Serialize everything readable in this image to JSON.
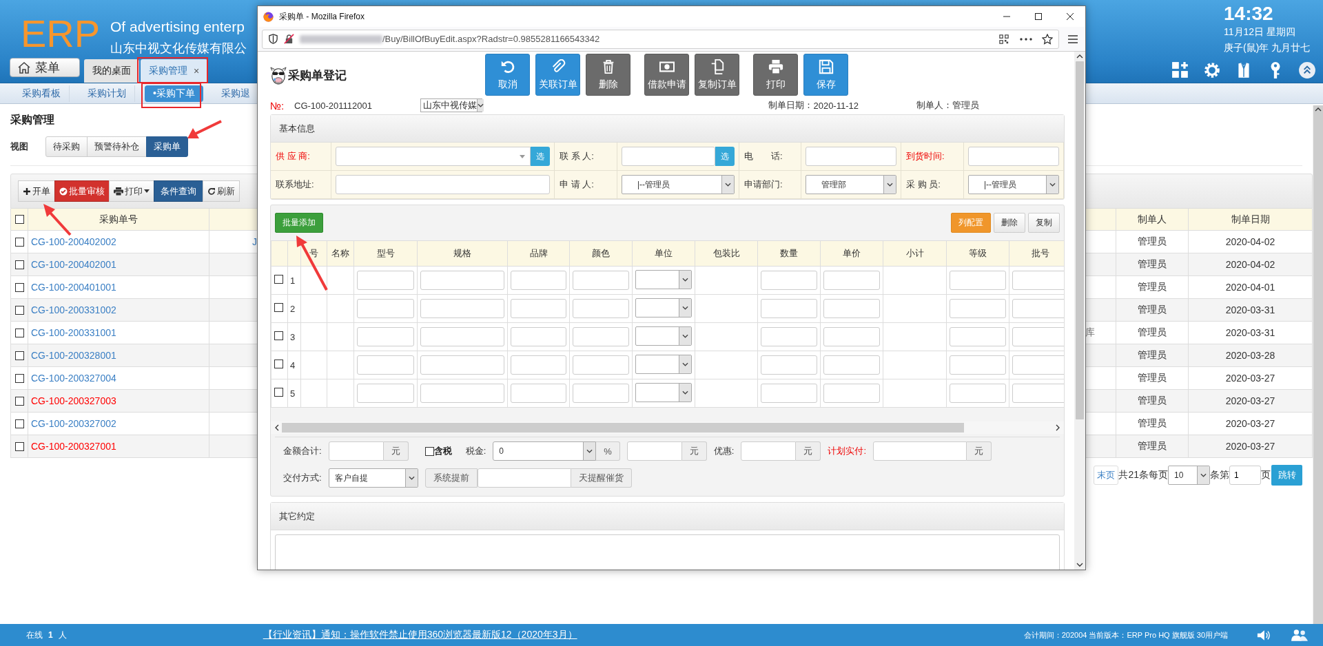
{
  "header": {
    "logo": "ERP",
    "slogan": "Of advertising enterp",
    "company": "山东中视文化传媒有限公",
    "menu_button": "菜单",
    "tabs": [
      {
        "label": "我的桌面",
        "selected": false,
        "closable": false
      },
      {
        "label": "采购管理",
        "selected": true,
        "closable": true,
        "close_label": "×"
      }
    ],
    "clock": {
      "time": "14:32",
      "date": "11月12日 星期四",
      "lunar": "庚子(鼠)年 九月廿七"
    },
    "tools": [
      {
        "kind": "apps"
      },
      {
        "kind": "settings"
      },
      {
        "kind": "shirt"
      },
      {
        "kind": "key"
      },
      {
        "kind": "collapse"
      }
    ]
  },
  "subnav": [
    {
      "label": "采购看板",
      "selected": false
    },
    {
      "label": "采购计划",
      "selected": false
    },
    {
      "label": "•采购下单",
      "selected": true
    },
    {
      "label": "采购退",
      "selected": false
    }
  ],
  "page": {
    "title": "采购管理",
    "view_label": "视图",
    "views": [
      {
        "label": "待采购",
        "selected": false
      },
      {
        "label": "预警待补仓",
        "selected": false
      },
      {
        "label": "采购单",
        "selected": true
      }
    ],
    "toolbar": [
      {
        "label": "开单",
        "kind": "add"
      },
      {
        "label": "批量审核",
        "kind": "approve"
      },
      {
        "label": "打印",
        "kind": "print"
      },
      {
        "label": "条件查询",
        "kind": "query"
      },
      {
        "label": "刷新",
        "kind": "refresh"
      }
    ],
    "table": {
      "all_checked": false,
      "columns": [
        "采购单号",
        "制单人",
        "制单日期"
      ],
      "rows": [
        {
          "checked": false,
          "number": "CG-100-200402002",
          "color": "#3a7fc4",
          "column_3": "J",
          "maker": "管理员",
          "date": "2020-04-02"
        },
        {
          "checked": false,
          "number": "CG-100-200402001",
          "color": "#3a7fc4",
          "maker": "管理员",
          "date": "2020-04-02"
        },
        {
          "checked": false,
          "number": "CG-100-200401001",
          "color": "#3a7fc4",
          "maker": "管理员",
          "date": "2020-04-01"
        },
        {
          "checked": false,
          "number": "CG-100-200331002",
          "color": "#3a7fc4",
          "maker": "管理员",
          "date": "2020-03-31"
        },
        {
          "checked": false,
          "number": "CG-100-200331001",
          "color": "#3a7fc4",
          "status": "库",
          "maker": "管理员",
          "date": "2020-03-31"
        },
        {
          "checked": false,
          "number": "CG-100-200328001",
          "color": "#3a7fc4",
          "maker": "管理员",
          "date": "2020-03-28"
        },
        {
          "checked": false,
          "number": "CG-100-200327004",
          "color": "#3a7fc4",
          "maker": "管理员",
          "date": "2020-03-27"
        },
        {
          "checked": false,
          "number": "CG-100-200327003",
          "color": "#ff0000",
          "maker": "管理员",
          "date": "2020-03-27"
        },
        {
          "checked": false,
          "number": "CG-100-200327002",
          "color": "#3a7fc4",
          "maker": "管理员",
          "date": "2020-03-27"
        },
        {
          "checked": false,
          "number": "CG-100-200327001",
          "color": "#ff0000",
          "maker": "管理员",
          "date": "2020-03-27"
        }
      ]
    },
    "pagination": {
      "last": "末页",
      "total": "共21条每页",
      "page_size": "10",
      "page_label": "条第",
      "page": "1",
      "page_unit": "页",
      "go": "跳转"
    }
  },
  "popup": {
    "window_title": "采购单 - Mozilla Firefox",
    "url": "/Buy/BillOfBuyEdit.aspx?Radstr=0.9855281166543342",
    "form_title": "采购单登记",
    "action_groups": [
      [
        {
          "label": "取消",
          "kind": "undo"
        },
        {
          "label": "关联订单",
          "kind": "attach"
        },
        {
          "label": "删除",
          "kind": "delete"
        }
      ],
      [
        {
          "label": "借款申请",
          "kind": "money"
        },
        {
          "label": "复制订单",
          "kind": "copy"
        }
      ],
      [
        {
          "label": "打印",
          "kind": "print"
        },
        {
          "label": "保存",
          "kind": "save"
        }
      ]
    ],
    "number_label": "№:",
    "number": "CG-100-201112001",
    "company": "山东中视传媒",
    "date_label": "制单日期：",
    "date": "2020-11-12",
    "maker_label": "制单人：",
    "maker": "管理员",
    "basic_info": {
      "title": "基本信息",
      "fields": [
        {
          "label": "供 应 商:",
          "required": true,
          "kind": "combo-pick",
          "pick": "选"
        },
        {
          "label": "联 系 人:",
          "required": false,
          "kind": "text-pick",
          "pick": "选"
        },
        {
          "label": "电　　话:",
          "required": false,
          "kind": "text"
        },
        {
          "label": "到货时间:",
          "required": true,
          "kind": "text"
        },
        {
          "label": "联系地址:",
          "required": false,
          "kind": "text"
        },
        {
          "label": "申 请 人:",
          "required": false,
          "kind": "select",
          "value": "|--管理员"
        },
        {
          "label": "申请部门:",
          "required": false,
          "kind": "select",
          "value": "管理部"
        },
        {
          "label": "采 购 员:",
          "required": false,
          "kind": "select",
          "value": "|--管理员"
        }
      ]
    },
    "items": {
      "add_button": "批量添加",
      "tools": [
        {
          "label": "列配置",
          "kind": "columns"
        },
        {
          "label": "删除",
          "kind": "delete"
        },
        {
          "label": "复制",
          "kind": "copy"
        }
      ],
      "columns": [
        {
          "kind": "check"
        },
        {
          "kind": "index"
        },
        {
          "label": "号",
          "kind": "plain"
        },
        {
          "label": "名称",
          "kind": "plain"
        },
        {
          "label": "型号",
          "kind": "input"
        },
        {
          "label": "规格",
          "kind": "input"
        },
        {
          "label": "品牌",
          "kind": "input"
        },
        {
          "label": "颜色",
          "kind": "input"
        },
        {
          "label": "单位",
          "kind": "select"
        },
        {
          "label": "包装比",
          "kind": "plain"
        },
        {
          "label": "数量",
          "kind": "input"
        },
        {
          "label": "单价",
          "kind": "input"
        },
        {
          "label": "小计",
          "kind": "plain"
        },
        {
          "label": "等级",
          "kind": "input"
        },
        {
          "label": "批号",
          "kind": "input"
        }
      ],
      "rows": [
        {
          "index": "1",
          "checked": false
        },
        {
          "index": "2",
          "checked": false
        },
        {
          "index": "3",
          "checked": false
        },
        {
          "index": "4",
          "checked": false
        },
        {
          "index": "5",
          "checked": false
        }
      ]
    },
    "totals": {
      "amount": {
        "label": "金额合计:",
        "required": false,
        "unit": "元"
      },
      "tax_included": {
        "label": "含税",
        "checked": false
      },
      "tax": {
        "label": "税金:",
        "required": false,
        "rate": "0",
        "percent": "%"
      },
      "tax_amount": {
        "unit": "元"
      },
      "discount": {
        "label": "优惠:",
        "required": false,
        "unit": "元"
      },
      "payable": {
        "label": "计划实付:",
        "required": true,
        "unit": "元"
      },
      "delivery": {
        "label": "交付方式:",
        "required": false,
        "value": "客户自提"
      },
      "reminder": {
        "prefix": "系统提前",
        "suffix": "天提醒催货"
      }
    },
    "other": {
      "title": "其它约定"
    }
  },
  "footer": {
    "online_label": "在线",
    "online_count": "1",
    "online_unit": "人",
    "news": "【行业资讯】通知：操作软件禁止使用360浏览器最新版12（2020年3月）",
    "version": "会计期间：202004 当前版本：ERP Pro HQ 旗舰版 30用户端"
  }
}
